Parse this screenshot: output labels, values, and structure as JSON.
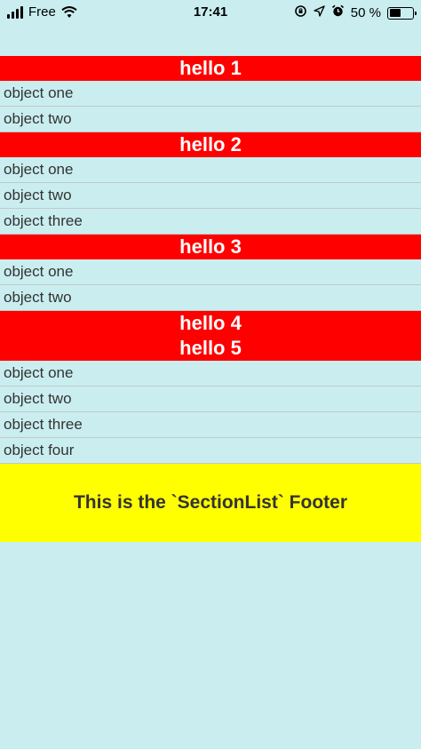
{
  "status_bar": {
    "carrier": "Free",
    "time": "17:41",
    "battery_text": "50 %",
    "battery_level": 0.5
  },
  "sections": [
    {
      "header": "hello 1",
      "items": [
        "object one",
        "object two"
      ]
    },
    {
      "header": "hello 2",
      "items": [
        "object one",
        "object two",
        "object three"
      ]
    },
    {
      "header": "hello 3",
      "items": [
        "object one",
        "object two"
      ]
    },
    {
      "header": "hello 4",
      "items": []
    },
    {
      "header": "hello 5",
      "items": [
        "object one",
        "object two",
        "object three",
        "object four"
      ]
    }
  ],
  "footer": {
    "text": "This is the `SectionList` Footer"
  },
  "colors": {
    "background": "#caeef0",
    "section_header": "#ff0000",
    "footer": "#ffff00"
  }
}
